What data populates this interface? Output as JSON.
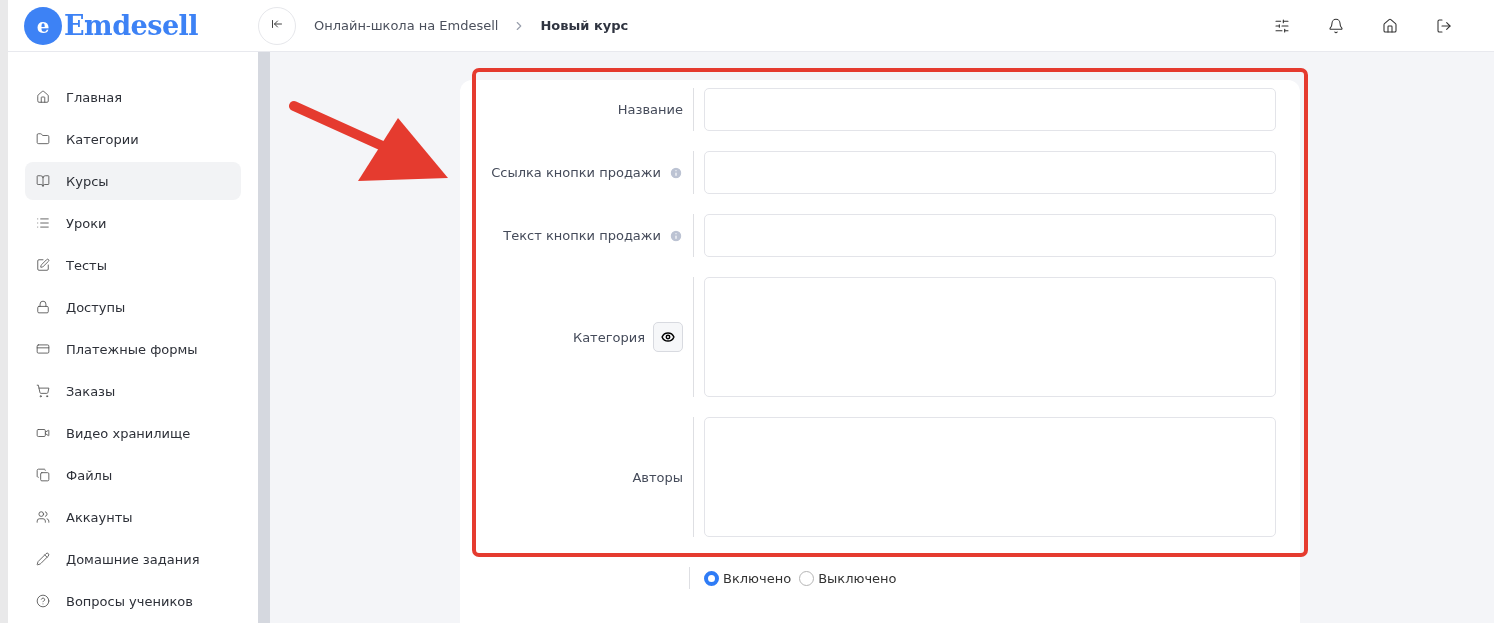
{
  "logo": {
    "letter": "e",
    "name": "Emdesell"
  },
  "breadcrumbs": [
    {
      "label": "Онлайн-школа на Emdesell",
      "current": false
    },
    {
      "label": "Новый курс",
      "current": true
    }
  ],
  "header_icons": [
    {
      "kind": "sliders"
    },
    {
      "kind": "bell"
    },
    {
      "kind": "home"
    },
    {
      "kind": "logout"
    }
  ],
  "sidebar": {
    "items": [
      {
        "label": "Главная",
        "kind": "home",
        "selected": false
      },
      {
        "label": "Категории",
        "kind": "folder",
        "selected": false
      },
      {
        "label": "Курсы",
        "kind": "book",
        "selected": true
      },
      {
        "label": "Уроки",
        "kind": "list",
        "selected": false
      },
      {
        "label": "Тесты",
        "kind": "edit",
        "selected": false
      },
      {
        "label": "Доступы",
        "kind": "lock",
        "selected": false
      },
      {
        "label": "Платежные формы",
        "kind": "card",
        "selected": false
      },
      {
        "label": "Заказы",
        "kind": "cart",
        "selected": false
      },
      {
        "label": "Видео хранилище",
        "kind": "video",
        "selected": false
      },
      {
        "label": "Файлы",
        "kind": "files",
        "selected": false
      },
      {
        "label": "Аккаунты",
        "kind": "users",
        "selected": false
      },
      {
        "label": "Домашние задания",
        "kind": "pencil",
        "selected": false
      },
      {
        "label": "Вопросы учеников",
        "kind": "help",
        "selected": false
      }
    ]
  },
  "form": {
    "fields": [
      {
        "label": "Название",
        "kind": "input",
        "info": false,
        "eye": false
      },
      {
        "label": "Ссылка кнопки продажи",
        "kind": "input",
        "info": true,
        "eye": false
      },
      {
        "label": "Текст кнопки продажи",
        "kind": "input",
        "info": true,
        "eye": false
      },
      {
        "label": "Категория",
        "kind": "textarea",
        "info": false,
        "eye": true
      },
      {
        "label": "Авторы",
        "kind": "textarea",
        "info": false,
        "eye": false
      },
      {
        "kind": "radio",
        "options": [
          {
            "label": "Включено",
            "selected": true
          },
          {
            "label": "Выключено",
            "selected": false
          }
        ]
      }
    ]
  }
}
